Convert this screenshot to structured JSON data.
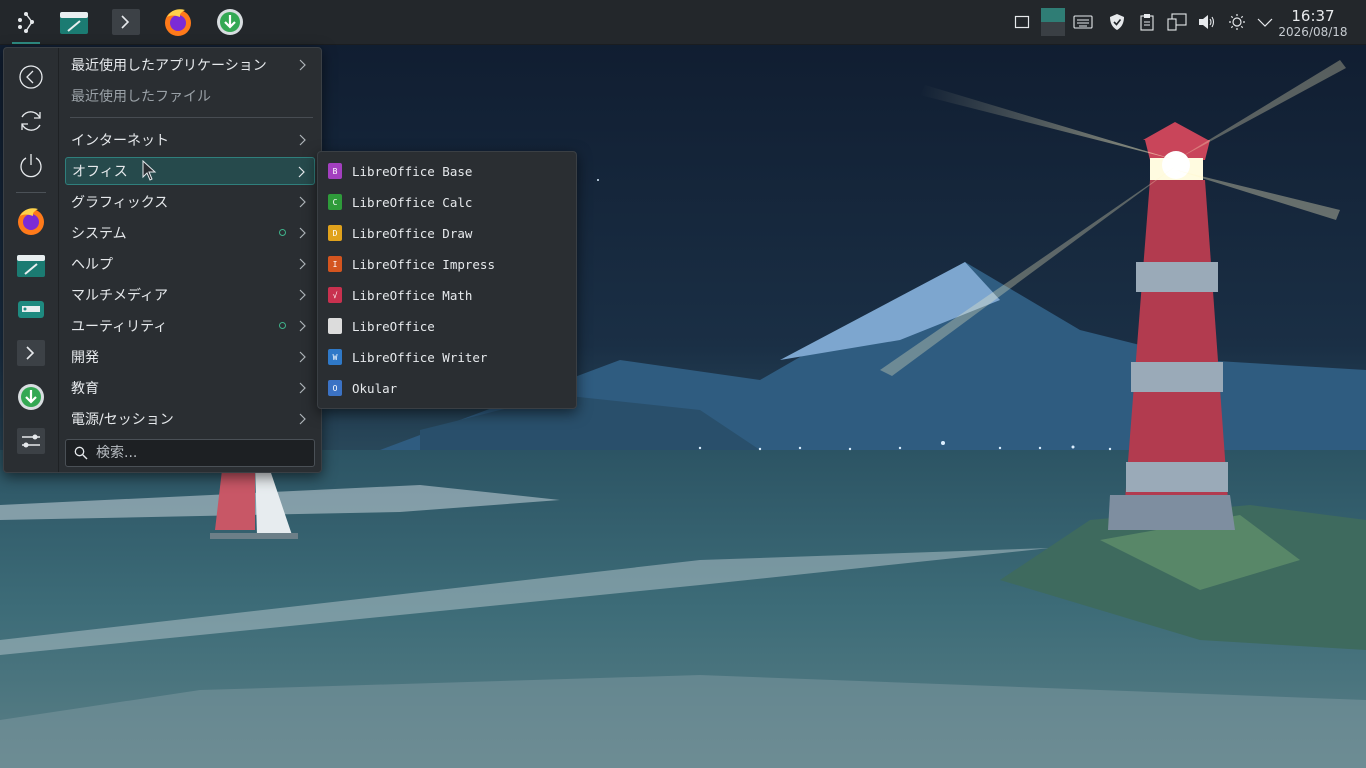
{
  "panel": {
    "launchers": [
      {
        "name": "application-launcher",
        "icon": "kde-launcher-icon"
      },
      {
        "name": "file-manager",
        "icon": "folder-icon"
      },
      {
        "name": "terminal",
        "icon": "terminal-icon"
      },
      {
        "name": "firefox",
        "icon": "firefox-icon"
      },
      {
        "name": "download-manager",
        "icon": "download-icon"
      }
    ],
    "tray_icons": [
      "show-desktop-icon",
      "pager-icon",
      "keyboard-icon",
      "shield-icon",
      "clipboard-icon",
      "network-icon",
      "volume-icon",
      "brightness-icon",
      "expand-tray-icon"
    ],
    "clock": {
      "time": "16:37",
      "date": "2026/08/18"
    }
  },
  "menu": {
    "sidebar": [
      "back-icon",
      "refresh-icon",
      "power-icon",
      "firefox-icon",
      "folder-icon",
      "disk-icon",
      "terminal-icon",
      "download-icon",
      "settings-icon"
    ],
    "items": [
      {
        "label": "最近使用したアプリケーション",
        "submenu": true
      },
      {
        "label": "最近使用したファイル",
        "submenu": false
      },
      {
        "label": "インターネット",
        "submenu": true
      },
      {
        "label": "オフィス",
        "submenu": true,
        "selected": true
      },
      {
        "label": "グラフィックス",
        "submenu": true
      },
      {
        "label": "システム",
        "submenu": true,
        "new": true
      },
      {
        "label": "ヘルプ",
        "submenu": true
      },
      {
        "label": "マルチメディア",
        "submenu": true
      },
      {
        "label": "ユーティリティ",
        "submenu": true,
        "new": true
      },
      {
        "label": "開発",
        "submenu": true
      },
      {
        "label": "教育",
        "submenu": true
      },
      {
        "label": "電源/セッション",
        "submenu": true
      }
    ],
    "search_placeholder": "検索..."
  },
  "submenu": {
    "items": [
      {
        "label": "LibreOffice Base",
        "color": "#a33fbf",
        "glyph": "B"
      },
      {
        "label": "LibreOffice Calc",
        "color": "#2e9b3a",
        "glyph": "C"
      },
      {
        "label": "LibreOffice Draw",
        "color": "#e0a21c",
        "glyph": "D"
      },
      {
        "label": "LibreOffice Impress",
        "color": "#d4551f",
        "glyph": "I"
      },
      {
        "label": "LibreOffice Math",
        "color": "#c8314f",
        "glyph": "√"
      },
      {
        "label": "LibreOffice",
        "color": "#dcdcdc",
        "glyph": ""
      },
      {
        "label": "LibreOffice Writer",
        "color": "#2f79c8",
        "glyph": "W"
      },
      {
        "label": "Okular",
        "color": "#3b72c4",
        "glyph": "O"
      }
    ]
  },
  "colors": {
    "accent": "#2f8f86",
    "panel_bg": "#23272b",
    "menu_bg": "#2a2e32"
  }
}
